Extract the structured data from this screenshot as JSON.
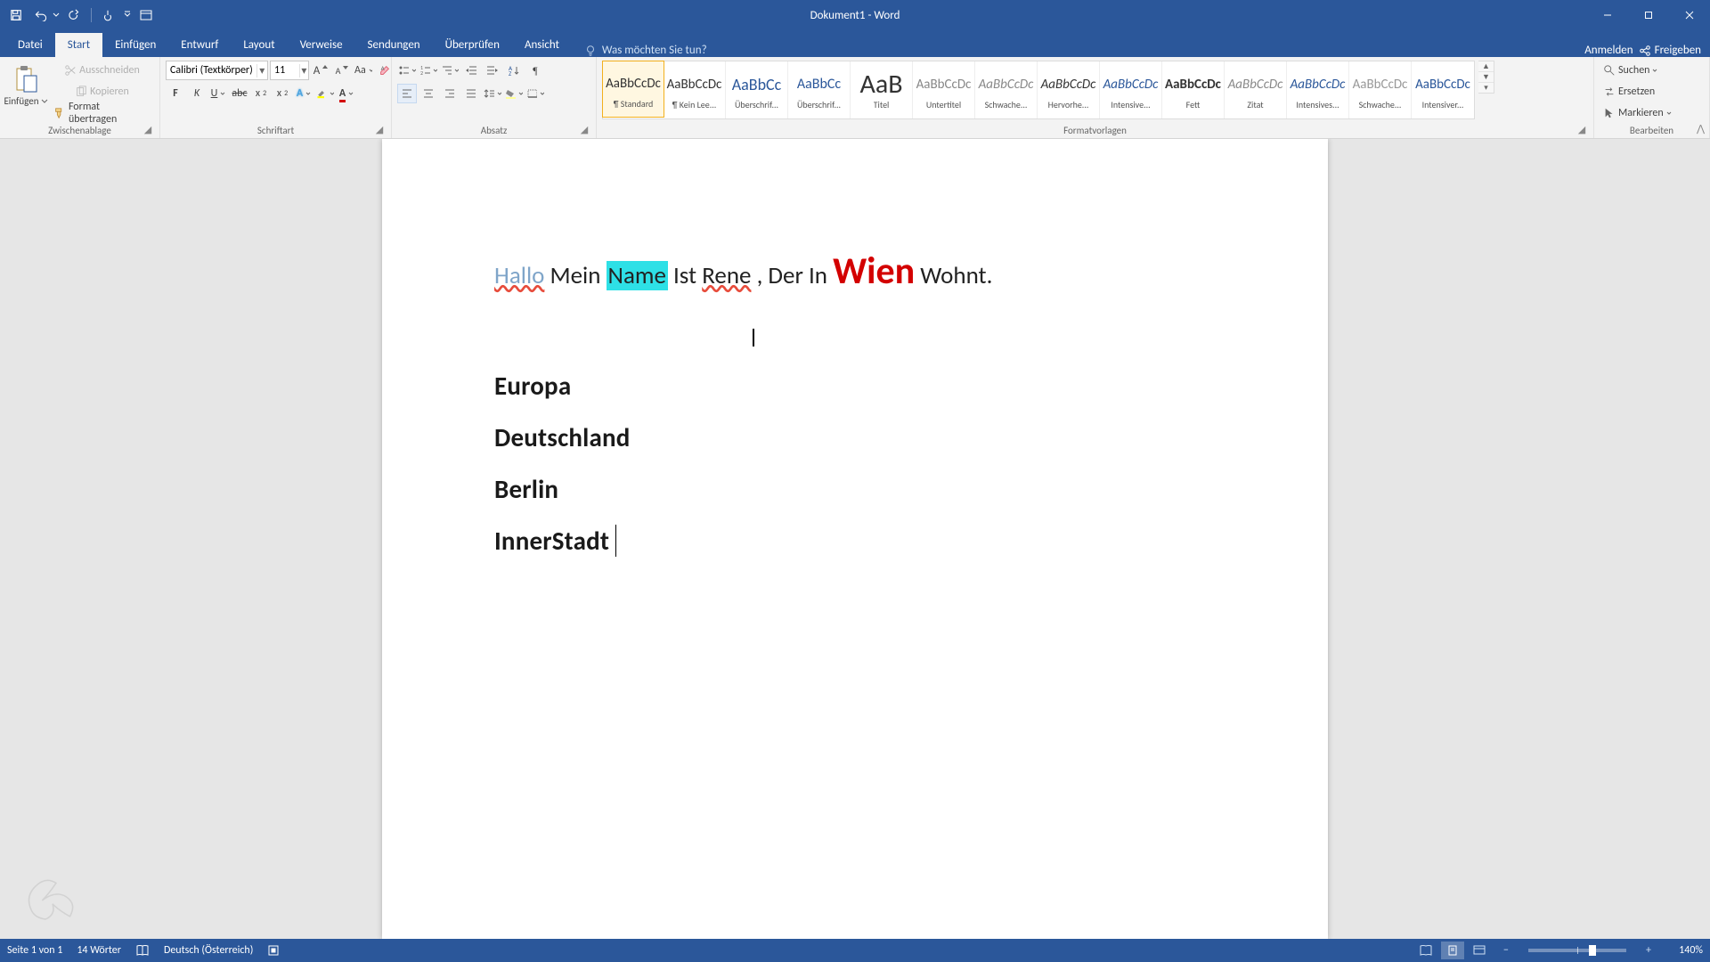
{
  "title": "Dokument1 - Word",
  "qat": {
    "save": "Speichern",
    "undo": "Rückgängig",
    "redo": "Wiederholen",
    "touch": "Touch-/Mausmodus"
  },
  "tabs": {
    "file": "Datei",
    "home": "Start",
    "insert": "Einfügen",
    "design": "Entwurf",
    "layout": "Layout",
    "references": "Verweise",
    "mailings": "Sendungen",
    "review": "Überprüfen",
    "view": "Ansicht",
    "tell_me": "Was möchten Sie tun?",
    "sign_in": "Anmelden",
    "share": "Freigeben"
  },
  "ribbon": {
    "clipboard": {
      "title": "Zwischenablage",
      "paste": "Einfügen",
      "cut": "Ausschneiden",
      "copy": "Kopieren",
      "format_painter": "Format übertragen"
    },
    "font": {
      "title": "Schriftart",
      "font_name": "Calibri (Textkörper)",
      "font_size": "11"
    },
    "paragraph": {
      "title": "Absatz"
    },
    "styles": {
      "title": "Formatvorlagen",
      "items": [
        {
          "preview": "AaBbCcDc",
          "label": "¶ Standard",
          "selected": true,
          "style": "color:#333"
        },
        {
          "preview": "AaBbCcDc",
          "label": "¶ Kein Lee...",
          "style": "color:#333"
        },
        {
          "preview": "AaBbCc",
          "label": "Überschrif...",
          "style": "color:#2b579a;font-size:18px"
        },
        {
          "preview": "AaBbCc",
          "label": "Überschrif...",
          "style": "color:#2b579a;font-size:16px"
        },
        {
          "preview": "AaB",
          "label": "Titel",
          "style": "font-size:30px;color:#333;font-weight:300"
        },
        {
          "preview": "AaBbCcDc",
          "label": "Untertitel",
          "style": "color:#888"
        },
        {
          "preview": "AaBbCcDc",
          "label": "Schwache...",
          "style": "color:#888;font-style:italic"
        },
        {
          "preview": "AaBbCcDc",
          "label": "Hervorhe...",
          "style": "font-style:italic;color:#333"
        },
        {
          "preview": "AaBbCcDc",
          "label": "Intensive...",
          "style": "color:#2b579a;font-style:italic"
        },
        {
          "preview": "AaBbCcDc",
          "label": "Fett",
          "style": "font-weight:bold;color:#333"
        },
        {
          "preview": "AaBbCcDc",
          "label": "Zitat",
          "style": "color:#888;font-style:italic"
        },
        {
          "preview": "AaBbCcDc",
          "label": "Intensives...",
          "style": "color:#2b579a;font-style:italic"
        },
        {
          "preview": "AaBbCcDc",
          "label": "Schwache...",
          "style": "color:#999"
        },
        {
          "preview": "AaBbCcDc",
          "label": "Intensiver...",
          "style": "color:#2b579a"
        }
      ]
    },
    "editing": {
      "title": "Bearbeiten",
      "find": "Suchen",
      "replace": "Ersetzen",
      "select": "Markieren"
    }
  },
  "document": {
    "line1": {
      "hallo": "Hallo",
      "mein": "Mein",
      "name": "Name",
      "ist": "Ist",
      "rene": "Rene",
      "comma": " ,",
      "der": "Der",
      "in": "In",
      "wien": "Wien",
      "wohnt": "Wohnt."
    },
    "headings": [
      "Europa",
      "Deutschland",
      "Berlin",
      "InnerStadt"
    ]
  },
  "status": {
    "page": "Seite 1 von 1",
    "words": "14 Wörter",
    "language": "Deutsch (Österreich)",
    "zoom": "140%"
  }
}
